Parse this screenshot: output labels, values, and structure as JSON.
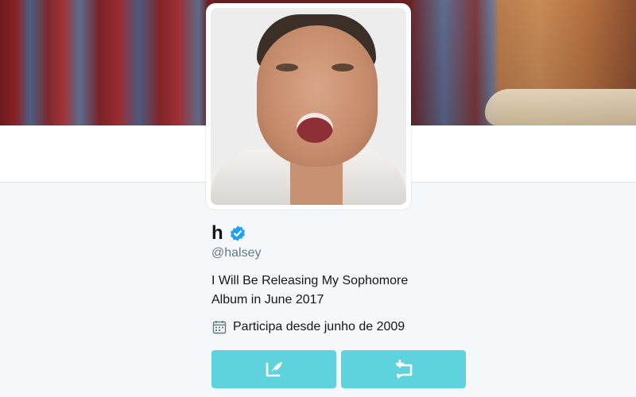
{
  "profile": {
    "name": "h",
    "handle": "@halsey",
    "bio_line1": "I Will Be Releasing My Sophomore",
    "bio_line2": "Album in June 2017",
    "joined": "Participa desde junho de 2009",
    "verified": true
  },
  "icons": {
    "verified": "verified-badge-icon",
    "calendar": "calendar-icon",
    "tweet_to": "compose-tweet-icon",
    "message": "direct-message-icon"
  },
  "colors": {
    "accent": "#5fd3dd",
    "verified": "#1da1f2",
    "text": "#14171a",
    "muted": "#657786",
    "background": "#f5f8fa"
  }
}
